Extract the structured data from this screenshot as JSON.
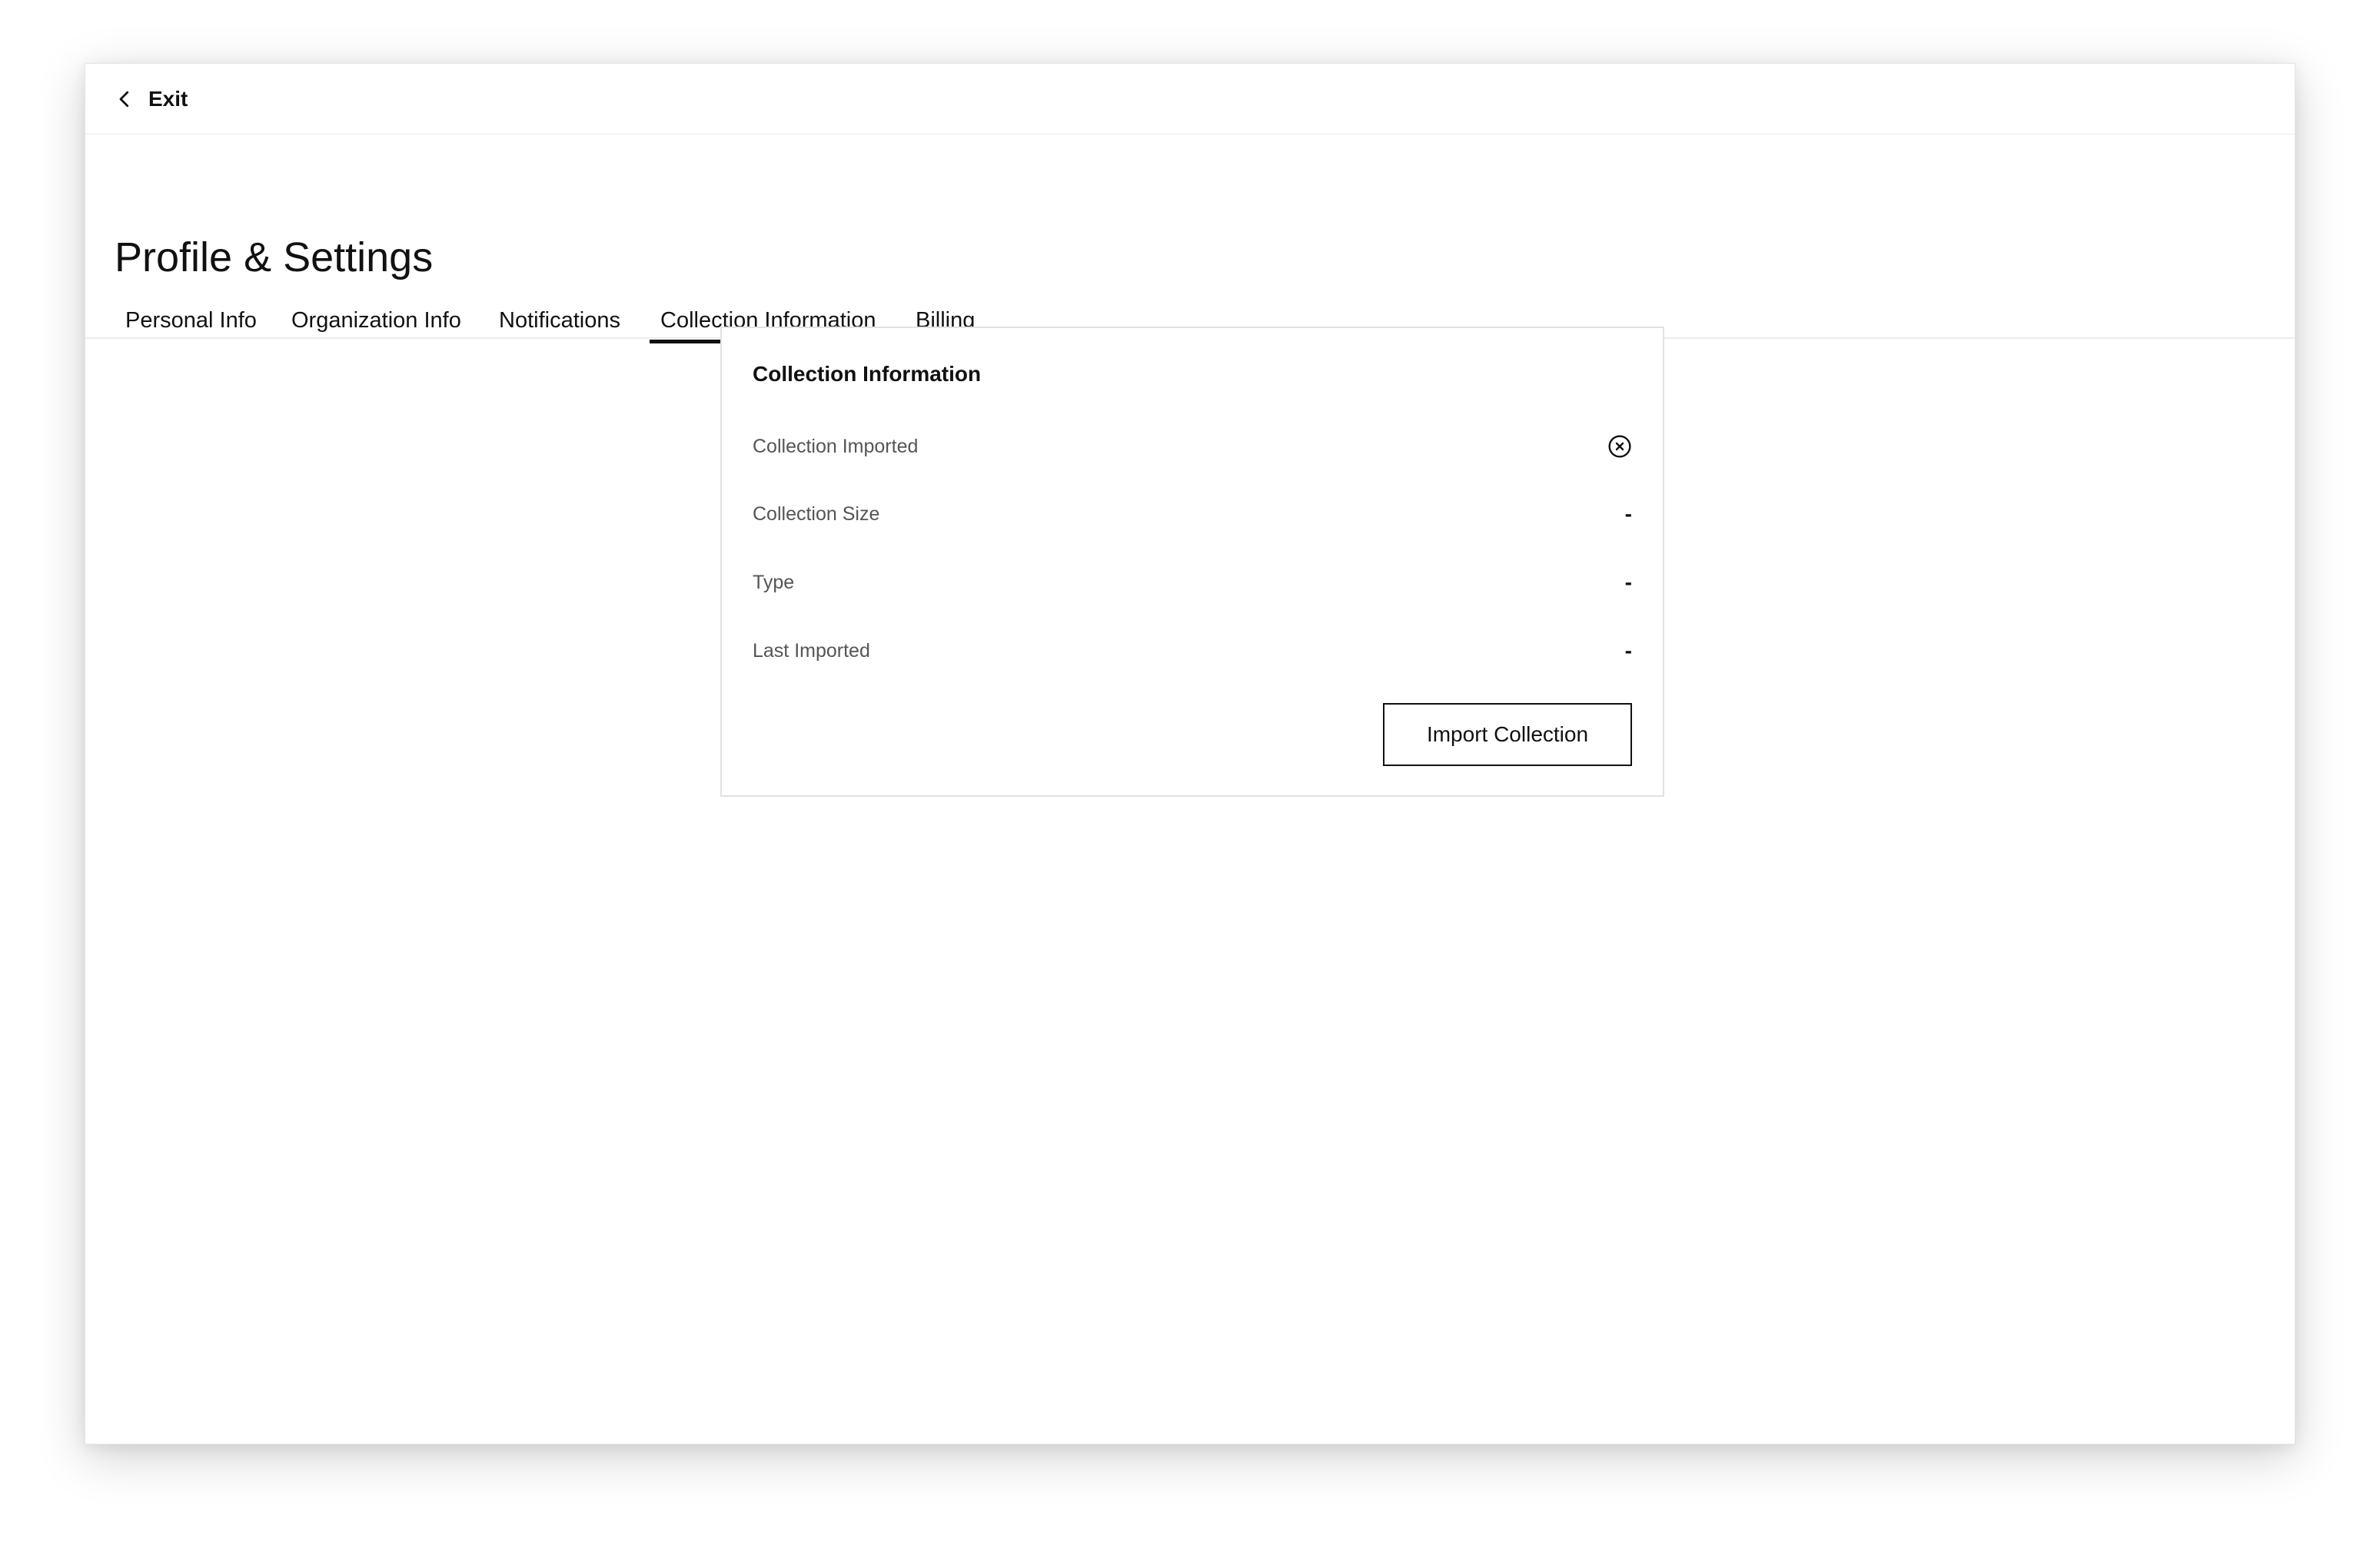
{
  "header": {
    "back_icon": "chevron-left-icon",
    "exit_label": "Exit"
  },
  "page": {
    "title": "Profile & Settings"
  },
  "tabs": [
    {
      "label": "Personal Info",
      "active": false
    },
    {
      "label": "Organization Info",
      "active": false
    },
    {
      "label": "Notifications",
      "active": false
    },
    {
      "label": "Collection Information",
      "active": true
    },
    {
      "label": "Billing",
      "active": false
    }
  ],
  "card": {
    "title": "Collection Information",
    "rows": [
      {
        "label": "Collection Imported",
        "value_icon": "x-circle-icon"
      },
      {
        "label": "Collection Size",
        "value": "-"
      },
      {
        "label": "Type",
        "value": "-"
      },
      {
        "label": "Last Imported",
        "value": "-"
      }
    ],
    "import_button_label": "Import Collection"
  },
  "colors": {
    "text": "#111111",
    "muted_text": "#555555",
    "border": "#e2e2e2",
    "background": "#ffffff"
  }
}
